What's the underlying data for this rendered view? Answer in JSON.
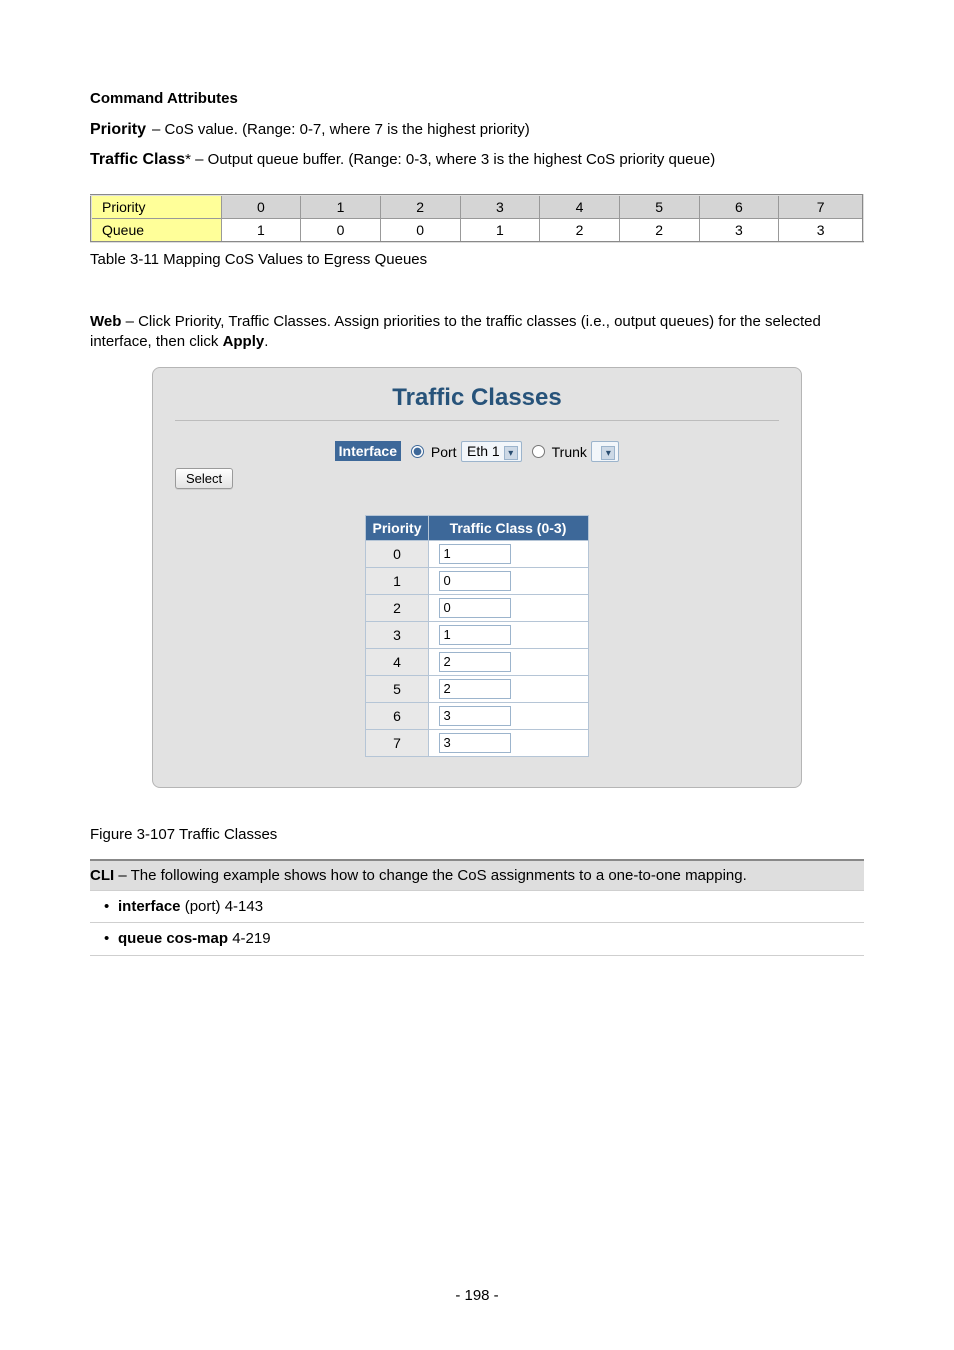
{
  "cmd": {
    "header": "Command Attributes",
    "priority": {
      "label": "Priority",
      "desc": "– CoS value. (Range: 0-7, where 7 is the highest priority)"
    },
    "traffic_class": {
      "label": "Traffic Class",
      "desc": " – Output queue buffer. (Range: 0-3, where 3 is the highest CoS priority queue)",
      "note": "*"
    }
  },
  "prio_table": {
    "row_labels": [
      "Priority",
      "Queue"
    ],
    "cols": [
      "0",
      "1",
      "2",
      "3",
      "4",
      "5",
      "6",
      "7"
    ],
    "map": [
      "1",
      "0",
      "0",
      "1",
      "2",
      "2",
      "3",
      "3"
    ],
    "caption": "Table 3-11 Mapping CoS Values to Egress Queues"
  },
  "web_para": {
    "b1": "Web",
    "t1": " – Click Priority, Traffic Classes. Assign priorities to the traffic classes (i.e., output queues) for the selected interface, then click ",
    "b2": "Apply",
    "t2": "."
  },
  "panel": {
    "title": "Traffic Classes",
    "interface_label": "Interface",
    "port_label": "Port",
    "port_select": "Eth 1",
    "trunk_label": "Trunk",
    "trunk_select": "",
    "select_button": "Select",
    "table_headers": [
      "Priority",
      "Traffic Class (0-3)"
    ],
    "rows": [
      {
        "p": "0",
        "v": "1"
      },
      {
        "p": "1",
        "v": "0"
      },
      {
        "p": "2",
        "v": "0"
      },
      {
        "p": "3",
        "v": "1"
      },
      {
        "p": "4",
        "v": "2"
      },
      {
        "p": "5",
        "v": "2"
      },
      {
        "p": "6",
        "v": "3"
      },
      {
        "p": "7",
        "v": "3"
      }
    ]
  },
  "fig_caption": "Figure 3-107 Traffic Classes",
  "cli": {
    "header_b": "CLI",
    "header_t": " – The following example shows how to change the CoS assignments to a one-to-one mapping.",
    "items": [
      {
        "key": "interface ",
        "link": "(port) 4-143"
      },
      {
        "key": "queue cos-map ",
        "link": "4-219"
      }
    ]
  },
  "page_no": "- 198 -"
}
